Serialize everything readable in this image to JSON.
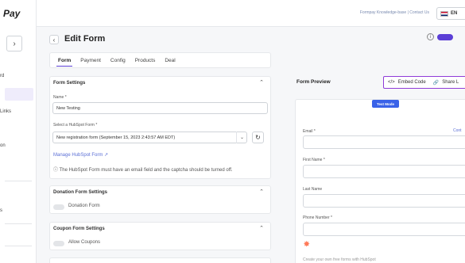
{
  "app": {
    "logo_text": "Pay"
  },
  "sidebar": {
    "items": [
      {
        "label": "rd"
      },
      {
        "label": ""
      },
      {
        "label": "Links"
      },
      {
        "label": "on"
      },
      {
        "label": "s"
      }
    ]
  },
  "topbar": {
    "links": "Formpay Knowledge-base | Contact Us",
    "language": "EN"
  },
  "header": {
    "title": "Edit Form"
  },
  "tabs": [
    {
      "label": "Form"
    },
    {
      "label": "Payment"
    },
    {
      "label": "Config"
    },
    {
      "label": "Products"
    },
    {
      "label": "Deal"
    }
  ],
  "form_settings": {
    "title": "Form Settings",
    "name_label": "Name *",
    "name_value": "New Testing",
    "select_label": "Select a HubSpot Form *",
    "select_value": "New registration form (September 15, 2023 2:43:57 AM EDT)",
    "manage_link": "Manage HubSpot Form",
    "note": "The HubSpot Form must have an email field and the captcha should be turned off."
  },
  "donation_settings": {
    "title": "Donation Form Settings",
    "toggle_label": "Donation Form"
  },
  "coupon_settings": {
    "title": "Coupon Form Settings",
    "toggle_label": "Allow Coupons"
  },
  "preview": {
    "title": "Form Preview",
    "embed_code": "Embed Code",
    "share_link": "Share L",
    "test_mode": "Test Mode",
    "fields": [
      {
        "label": "Email *"
      },
      {
        "label": "First Name *"
      },
      {
        "label": "Last Name"
      },
      {
        "label": "Phone Number *"
      }
    ],
    "side_link": "Cont",
    "footer_text": "Create your own free forms with HubSpot"
  },
  "colors": {
    "accent": "#5b3fd6",
    "embed_border": "#8f3bd8",
    "badge": "#3a62e8"
  }
}
